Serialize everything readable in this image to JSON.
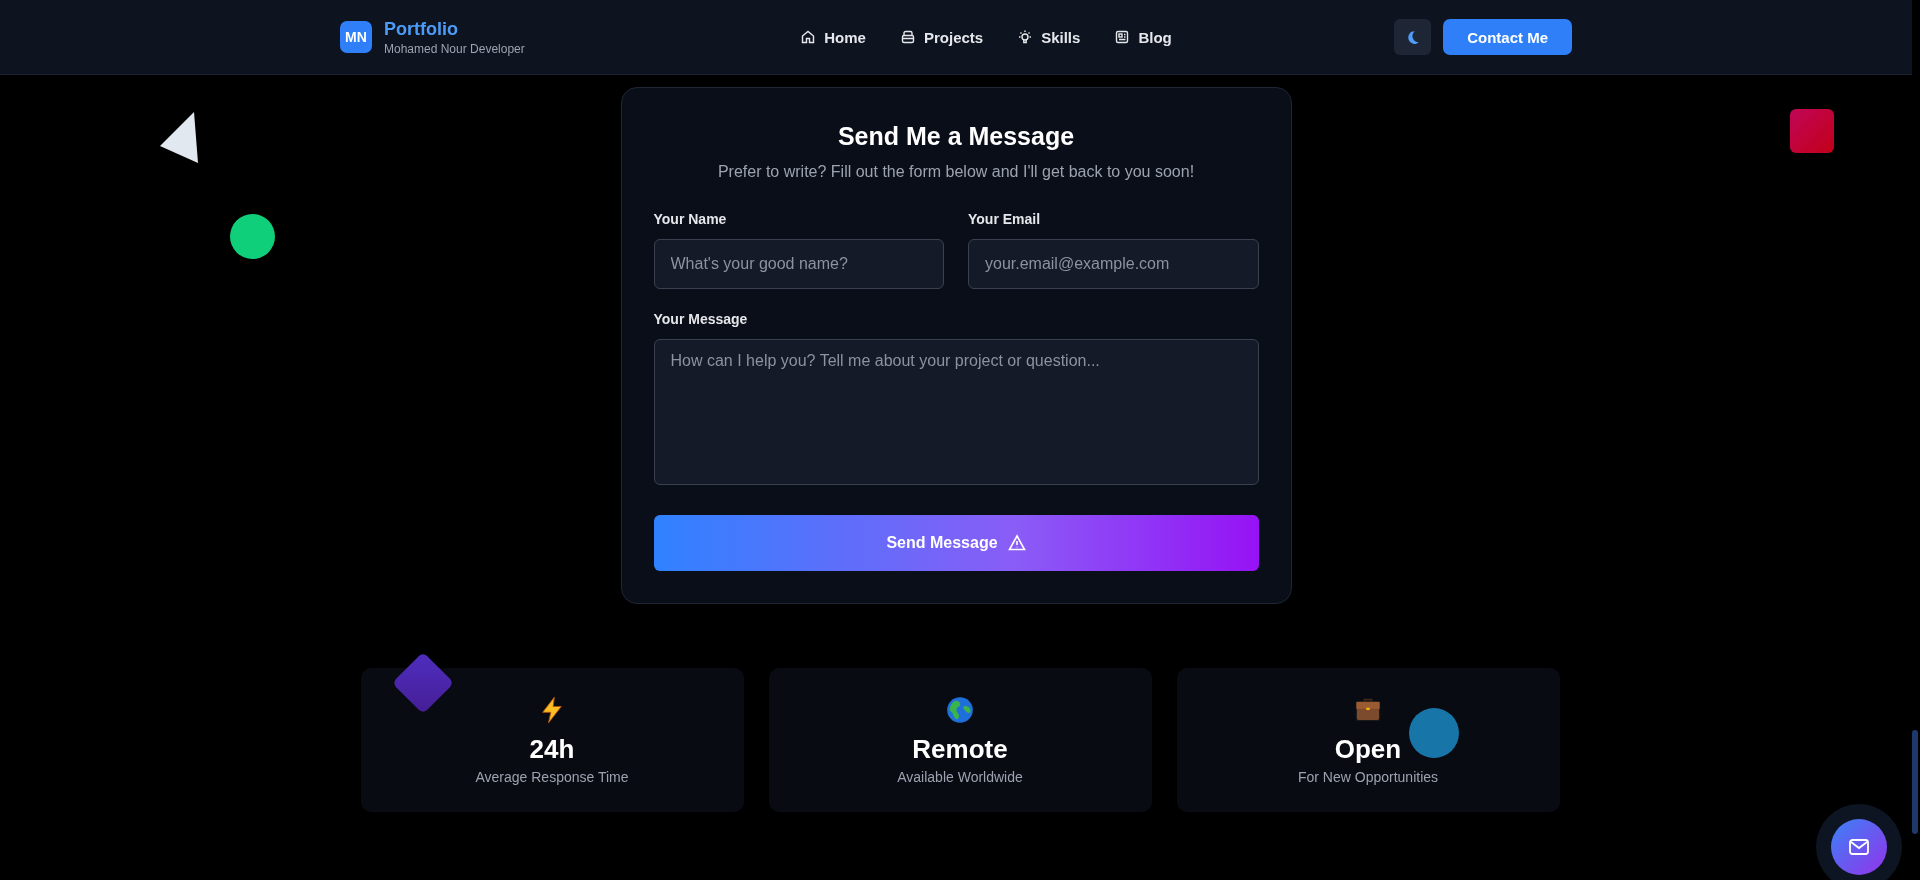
{
  "header": {
    "logo_badge": "MN",
    "brand": "Portfolio",
    "tagline": "Mohamed Nour Developer",
    "nav": [
      {
        "label": "Home",
        "kind": "home"
      },
      {
        "label": "Projects",
        "kind": "box"
      },
      {
        "label": "Skills",
        "kind": "bulb"
      },
      {
        "label": "Blog",
        "kind": "news"
      }
    ],
    "contact_button": "Contact Me"
  },
  "form": {
    "title": "Send Me a Message",
    "subtitle": "Prefer to write? Fill out the form below and I'll get back to you soon!",
    "fields": [
      {
        "kind": "input",
        "label": "Your Name",
        "placeholder": "What's your good name?"
      },
      {
        "kind": "input",
        "label": "Your Email",
        "placeholder": "your.email@example.com"
      },
      {
        "kind": "textarea",
        "label": "Your Message",
        "placeholder": "How can I help you? Tell me about your project or question..."
      }
    ],
    "submit": "Send Message"
  },
  "stats": [
    {
      "kind": "bolt",
      "value": "24h",
      "caption": "Average Response Time"
    },
    {
      "kind": "globe",
      "value": "Remote",
      "caption": "Available Worldwide"
    },
    {
      "kind": "briefcase",
      "value": "Open",
      "caption": "For New Opportunities"
    }
  ]
}
